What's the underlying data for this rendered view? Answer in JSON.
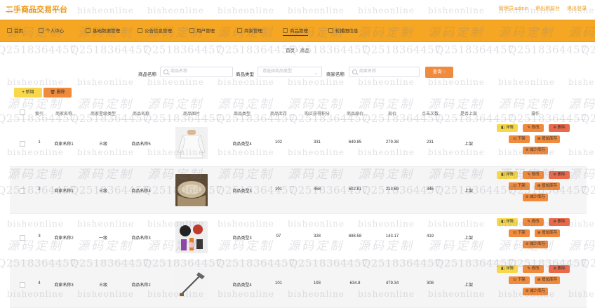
{
  "app": {
    "title": "二手商品交易平台"
  },
  "user": {
    "label": "管理员 admin",
    "logout_to_front": "退出到前台",
    "logout": "退出登录"
  },
  "nav": {
    "items": [
      {
        "label": "首页"
      },
      {
        "label": "个人中心"
      },
      {
        "label": "基础数据管理"
      },
      {
        "label": "公告信息管理"
      },
      {
        "label": "用户管理"
      },
      {
        "label": "商家管理"
      },
      {
        "label": "商品管理"
      },
      {
        "label": "轮播图信息"
      }
    ]
  },
  "breadcrumb": {
    "home": "首页",
    "sep": "/",
    "current": "商品"
  },
  "search": {
    "name_label": "商品名称",
    "name_placeholder": "商品名称",
    "type_label": "商品类型",
    "type_placeholder": "请选择商品类型",
    "merchant_label": "商家名称",
    "merchant_placeholder": "商家名称",
    "query_button": "查询"
  },
  "actions": {
    "add": "新增",
    "delete": "删除"
  },
  "table": {
    "columns": [
      "索引",
      "商家名称",
      "商家星级类型",
      "商品名称",
      "商品图片",
      "商品类型",
      "商品库存",
      "购买获得积分",
      "商品原价",
      "现价",
      "点击次数",
      "是否上架",
      "操作"
    ],
    "rows": [
      {
        "index": "1",
        "merchant": "商家名称1",
        "star": "三级",
        "name": "商品名称5",
        "type": "商品类型4",
        "stock": "102",
        "points": "331",
        "orig": "649.85",
        "price": "279.38",
        "clicks": "231",
        "status": "上架",
        "img": "shirt"
      },
      {
        "index": "2",
        "merchant": "商家名称1",
        "star": "三级",
        "name": "商品名称4",
        "type": "商品类型3",
        "stock": "101",
        "points": "458",
        "orig": "502.81",
        "price": "213.69",
        "clicks": "346",
        "status": "上架",
        "img": "fabric"
      },
      {
        "index": "3",
        "merchant": "商家名称2",
        "star": "一级",
        "name": "商品名称3",
        "type": "商品类型3",
        "stock": "97",
        "points": "328",
        "orig": "698.58",
        "price": "143.17",
        "clicks": "419",
        "status": "上架",
        "img": "cosmetics"
      },
      {
        "index": "4",
        "merchant": "商家名称3",
        "star": "三级",
        "name": "商品名称2",
        "type": "商品类型4",
        "stock": "101",
        "points": "193",
        "orig": "634.8",
        "price": "479.34",
        "clicks": "308",
        "status": "上架",
        "img": "tool"
      }
    ],
    "ops": {
      "detail": "详情",
      "edit": "修改",
      "delete": "删除",
      "off_shelf": "下架",
      "add_stock": "增加库存",
      "reduce_stock": "减少库存"
    }
  },
  "watermark": {
    "site": "bisheonline",
    "cn": "源码定制",
    "qq": "Q2518364457"
  },
  "colors": {
    "accent": "#f5a623",
    "title": "#f39c12",
    "yellow": "#f7d84b",
    "orange": "#f08a3c",
    "red": "#e86a4a"
  }
}
